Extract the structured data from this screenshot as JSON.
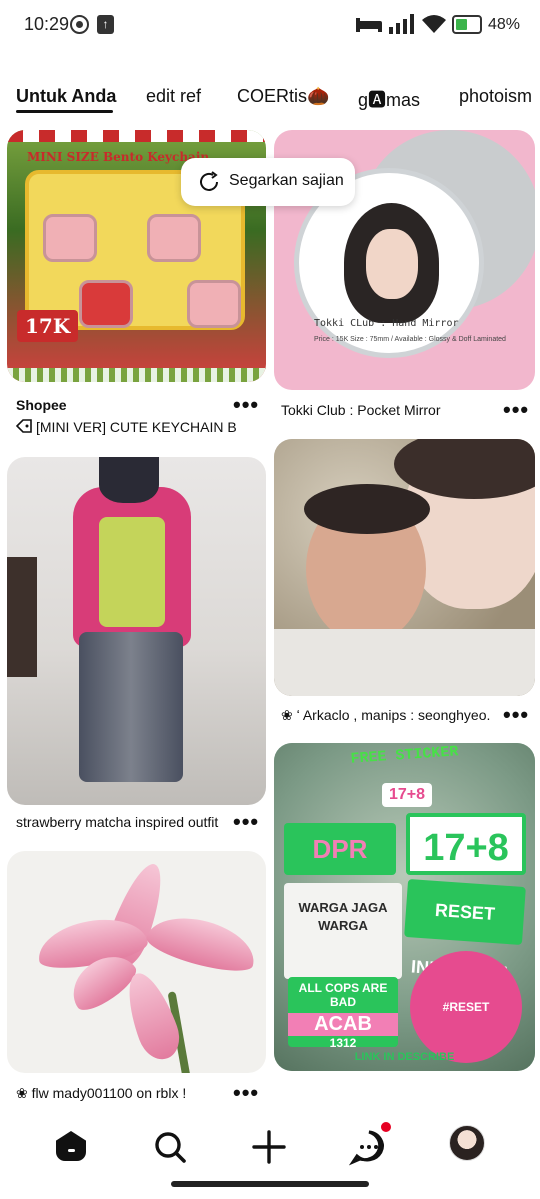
{
  "status": {
    "time": "10:29",
    "battery": "48%",
    "battery_level": 0.48
  },
  "tabs": [
    {
      "label": "Untuk Anda",
      "active": true
    },
    {
      "label": "edit ref",
      "active": false
    },
    {
      "label": "COERtis🌰",
      "active": false
    },
    {
      "label": "g🅰mas",
      "active": false
    },
    {
      "label": "photoism",
      "active": false
    }
  ],
  "refresh": {
    "label": "Segarkan sajian"
  },
  "pins": [
    {
      "source": "Shopee",
      "title": "[MINI VER] CUTE KEYCHAIN B..."
    },
    {
      "title": "Tokki Club : Pocket Mirror"
    },
    {
      "title": "strawberry matcha inspired outfit"
    },
    {
      "title": "❀ ʻ Arkaclo , manips : seonghyeo..."
    },
    {
      "title": "❀ flw mady001100 on rblx !"
    }
  ],
  "pin_art": {
    "keychain": {
      "top": "MINI SIZE Bento Keychain",
      "price": "17K"
    },
    "mirror": {
      "label": "Tokki CLub : Hand Mirror",
      "sub": "Price : 15K  Size : 75mm / Available : Glossy & Doff Laminated"
    },
    "sticker": {
      "title": "FREE STICKER",
      "num_small": "17+8",
      "dpr": "DPR",
      "num_big": "17+8",
      "warga": "WARGA JAGA WARGA",
      "reset": "RESET INDONESIA",
      "acab_top": "ALL COPS ARE BAD",
      "acab": "ACAB",
      "acab_num": "1312",
      "circle": "#RESET",
      "link": "LINK IN DESCRIBE"
    }
  },
  "more_label": "•••",
  "nav": [
    "home-icon",
    "search-icon",
    "create-icon",
    "messages-icon",
    "profile-avatar"
  ],
  "colors": {
    "accent": "#e60023",
    "tab_underline": "#111111"
  }
}
